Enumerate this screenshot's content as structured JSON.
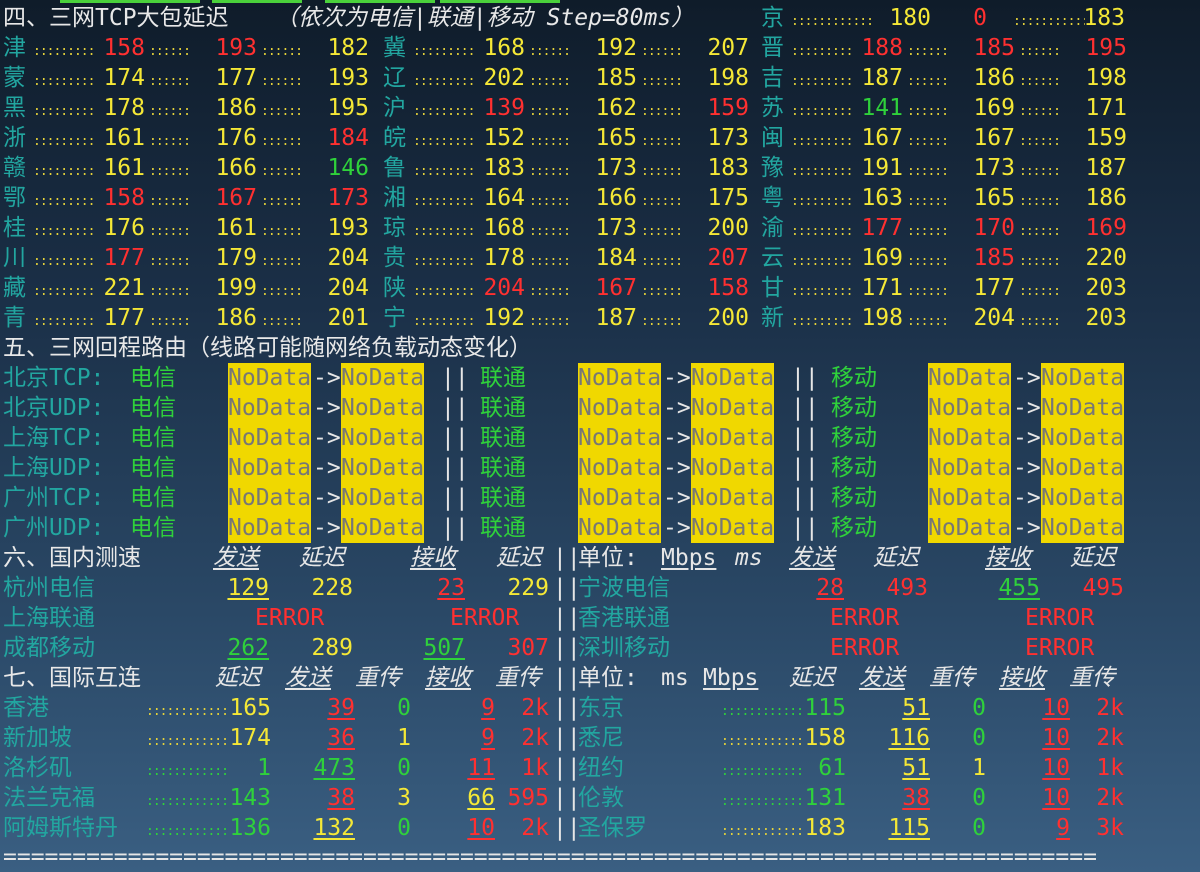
{
  "sec4": {
    "title": "四、三网TCP大包延迟",
    "note": "（依次为电信|联通|移动 Step=80ms）",
    "jing": {
      "name": "京",
      "v1": "180",
      "v2": "0",
      "v3": "183"
    },
    "rows": [
      [
        {
          "n": "津",
          "a": "158",
          "b": "193",
          "c": "182",
          "ca": "red",
          "cb": "red",
          "cc": "yel"
        },
        {
          "n": "冀",
          "a": "168",
          "b": "192",
          "c": "207",
          "ca": "yel",
          "cb": "yel",
          "cc": "yel"
        },
        {
          "n": "晋",
          "a": "188",
          "b": "185",
          "c": "195",
          "ca": "red",
          "cb": "red",
          "cc": "red"
        }
      ],
      [
        {
          "n": "蒙",
          "a": "174",
          "b": "177",
          "c": "193",
          "ca": "yel",
          "cb": "yel",
          "cc": "yel"
        },
        {
          "n": "辽",
          "a": "202",
          "b": "185",
          "c": "198",
          "ca": "yel",
          "cb": "yel",
          "cc": "yel"
        },
        {
          "n": "吉",
          "a": "187",
          "b": "186",
          "c": "198",
          "ca": "yel",
          "cb": "yel",
          "cc": "yel"
        }
      ],
      [
        {
          "n": "黑",
          "a": "178",
          "b": "186",
          "c": "195",
          "ca": "yel",
          "cb": "yel",
          "cc": "yel"
        },
        {
          "n": "沪",
          "a": "139",
          "b": "162",
          "c": "159",
          "ca": "red",
          "cb": "yel",
          "cc": "red"
        },
        {
          "n": "苏",
          "a": "141",
          "b": "169",
          "c": "171",
          "ca": "grn",
          "cb": "yel",
          "cc": "yel"
        }
      ],
      [
        {
          "n": "浙",
          "a": "161",
          "b": "176",
          "c": "184",
          "ca": "yel",
          "cb": "yel",
          "cc": "red"
        },
        {
          "n": "皖",
          "a": "152",
          "b": "165",
          "c": "173",
          "ca": "yel",
          "cb": "yel",
          "cc": "yel"
        },
        {
          "n": "闽",
          "a": "167",
          "b": "167",
          "c": "159",
          "ca": "yel",
          "cb": "yel",
          "cc": "yel"
        }
      ],
      [
        {
          "n": "赣",
          "a": "161",
          "b": "166",
          "c": "146",
          "ca": "yel",
          "cb": "yel",
          "cc": "grn"
        },
        {
          "n": "鲁",
          "a": "183",
          "b": "173",
          "c": "183",
          "ca": "yel",
          "cb": "yel",
          "cc": "yel"
        },
        {
          "n": "豫",
          "a": "191",
          "b": "173",
          "c": "187",
          "ca": "yel",
          "cb": "yel",
          "cc": "yel"
        }
      ],
      [
        {
          "n": "鄂",
          "a": "158",
          "b": "167",
          "c": "173",
          "ca": "red",
          "cb": "red",
          "cc": "red"
        },
        {
          "n": "湘",
          "a": "164",
          "b": "166",
          "c": "175",
          "ca": "yel",
          "cb": "yel",
          "cc": "yel"
        },
        {
          "n": "粤",
          "a": "163",
          "b": "165",
          "c": "186",
          "ca": "yel",
          "cb": "yel",
          "cc": "yel"
        }
      ],
      [
        {
          "n": "桂",
          "a": "176",
          "b": "161",
          "c": "193",
          "ca": "yel",
          "cb": "yel",
          "cc": "yel"
        },
        {
          "n": "琼",
          "a": "168",
          "b": "173",
          "c": "200",
          "ca": "yel",
          "cb": "yel",
          "cc": "yel"
        },
        {
          "n": "渝",
          "a": "177",
          "b": "170",
          "c": "169",
          "ca": "red",
          "cb": "red",
          "cc": "red"
        }
      ],
      [
        {
          "n": "川",
          "a": "177",
          "b": "179",
          "c": "204",
          "ca": "red",
          "cb": "yel",
          "cc": "yel"
        },
        {
          "n": "贵",
          "a": "178",
          "b": "184",
          "c": "207",
          "ca": "yel",
          "cb": "yel",
          "cc": "red"
        },
        {
          "n": "云",
          "a": "169",
          "b": "185",
          "c": "220",
          "ca": "yel",
          "cb": "red",
          "cc": "yel"
        }
      ],
      [
        {
          "n": "藏",
          "a": "221",
          "b": "199",
          "c": "204",
          "ca": "yel",
          "cb": "yel",
          "cc": "yel"
        },
        {
          "n": "陕",
          "a": "204",
          "b": "167",
          "c": "158",
          "ca": "red",
          "cb": "red",
          "cc": "red"
        },
        {
          "n": "甘",
          "a": "171",
          "b": "177",
          "c": "203",
          "ca": "yel",
          "cb": "yel",
          "cc": "yel"
        }
      ],
      [
        {
          "n": "青",
          "a": "177",
          "b": "186",
          "c": "201",
          "ca": "yel",
          "cb": "yel",
          "cc": "yel"
        },
        {
          "n": "宁",
          "a": "192",
          "b": "187",
          "c": "200",
          "ca": "yel",
          "cb": "yel",
          "cc": "yel"
        },
        {
          "n": "新",
          "a": "198",
          "b": "204",
          "c": "203",
          "ca": "yel",
          "cb": "yel",
          "cc": "yel"
        }
      ]
    ]
  },
  "sec5": {
    "title": "五、三网回程路由（线路可能随网络负载动态变化）",
    "isp": {
      "t": "电信",
      "u": "联通",
      "m": "移动"
    },
    "nodata": "NoData",
    "arrow": "->",
    "sep": "||",
    "rows": [
      "北京TCP:",
      "北京UDP:",
      "上海TCP:",
      "上海UDP:",
      "广州TCP:",
      "广州UDP:"
    ]
  },
  "sec6": {
    "title": "六、国内测速",
    "send": "发送",
    "lat": "延迟",
    "recv": "接收",
    "unit": "单位:",
    "mbps": "Mbps",
    "ms": "ms",
    "error": "ERROR",
    "left": [
      {
        "n": "杭州电信",
        "s": "129",
        "l1": "228",
        "r": "23",
        "l2": "229",
        "cs": "yel",
        "cr": "red",
        "cl2": "yel"
      },
      {
        "n": "上海联通",
        "err": true
      },
      {
        "n": "成都移动",
        "s": "262",
        "l1": "289",
        "r": "507",
        "l2": "307",
        "cs": "grn",
        "cr": "grn",
        "cl2": "red"
      }
    ],
    "right": [
      {
        "n": "宁波电信",
        "s": "28",
        "l1": "493",
        "r": "455",
        "l2": "495",
        "cs": "red",
        "cr": "grn",
        "cl2": "red"
      },
      {
        "n": "香港联通",
        "err": true
      },
      {
        "n": "深圳移动",
        "err": true
      }
    ]
  },
  "sec7": {
    "title": "七、国际互连",
    "lat": "延迟",
    "send": "发送",
    "retx": "重传",
    "recv": "接收",
    "unit": "单位:",
    "ms": "ms",
    "mbps": "Mbps",
    "left": [
      {
        "n": "香港",
        "lat": "165",
        "lc": "yel",
        "s": "39",
        "sc": "red",
        "r1": "0",
        "r1c": "grn",
        "rv": "9",
        "rc": "red",
        "r2": "2k",
        "r2c": "red"
      },
      {
        "n": "新加坡",
        "lat": "174",
        "lc": "yel",
        "s": "36",
        "sc": "red",
        "r1": "1",
        "r1c": "yel",
        "rv": "9",
        "rc": "red",
        "r2": "2k",
        "r2c": "red"
      },
      {
        "n": "洛杉矶",
        "lat": "1",
        "lc": "grn",
        "s": "473",
        "sc": "grn",
        "r1": "0",
        "r1c": "grn",
        "rv": "11",
        "rc": "red",
        "r2": "1k",
        "r2c": "red"
      },
      {
        "n": "法兰克福",
        "lat": "143",
        "lc": "grn",
        "s": "38",
        "sc": "red",
        "r1": "3",
        "r1c": "yel",
        "rv": "66",
        "rc": "yel",
        "r2": "595",
        "r2c": "red"
      },
      {
        "n": "阿姆斯特丹",
        "lat": "136",
        "lc": "grn",
        "s": "132",
        "sc": "yel",
        "r1": "0",
        "r1c": "grn",
        "rv": "10",
        "rc": "red",
        "r2": "2k",
        "r2c": "red"
      }
    ],
    "right": [
      {
        "n": "东京",
        "lat": "115",
        "lc": "grn",
        "s": "51",
        "sc": "yel",
        "r1": "0",
        "r1c": "grn",
        "rv": "10",
        "rc": "red",
        "r2": "2k",
        "r2c": "red"
      },
      {
        "n": "悉尼",
        "lat": "158",
        "lc": "yel",
        "s": "116",
        "sc": "yel",
        "r1": "0",
        "r1c": "grn",
        "rv": "10",
        "rc": "red",
        "r2": "2k",
        "r2c": "red"
      },
      {
        "n": "纽约",
        "lat": "61",
        "lc": "grn",
        "s": "51",
        "sc": "yel",
        "r1": "1",
        "r1c": "yel",
        "rv": "10",
        "rc": "red",
        "r2": "1k",
        "r2c": "red"
      },
      {
        "n": "伦敦",
        "lat": "131",
        "lc": "grn",
        "s": "38",
        "sc": "red",
        "r1": "0",
        "r1c": "grn",
        "rv": "10",
        "rc": "red",
        "r2": "2k",
        "r2c": "red"
      },
      {
        "n": "圣保罗",
        "lat": "183",
        "lc": "yel",
        "s": "115",
        "sc": "yel",
        "r1": "0",
        "r1c": "grn",
        "rv": "9",
        "rc": "red",
        "r2": "3k",
        "r2c": "red"
      }
    ]
  },
  "footer": "==============================================================================="
}
